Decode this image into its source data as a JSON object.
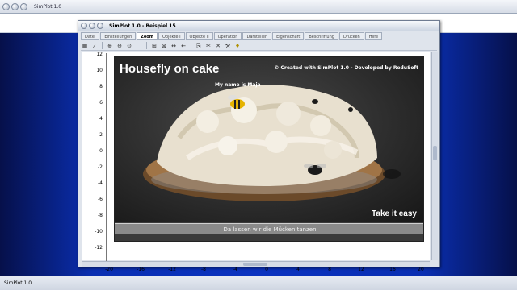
{
  "outer_window": {
    "title": "SimPlot 1.0"
  },
  "statusbar": {
    "text": "SimPlot 1.0"
  },
  "inner_window": {
    "title": "SimPlot 1.0 - Beispiel 15"
  },
  "tabs": [
    "Datei",
    "Einstellungen",
    "Zoom",
    "Objekte I",
    "Objekte II",
    "Operation",
    "Darstellen",
    "Eigenschaft",
    "Beschriftung",
    "Drucken",
    "Hilfe"
  ],
  "active_tab": "Zoom",
  "toolbar": {
    "icons": [
      "calculator-icon",
      "abs-icon",
      "zoom-in-icon",
      "zoom-out-icon",
      "zoom-fit-icon",
      "square-icon",
      "grid-icon",
      "grid-alt-icon",
      "arrow-left-right-icon",
      "arrow-left-icon",
      "copy-icon",
      "cut-icon",
      "delete-icon",
      "tools-icon",
      "help-bulb-icon"
    ]
  },
  "plot": {
    "y_ticks": [
      "12",
      "10",
      "8",
      "6",
      "4",
      "2",
      "0",
      "-2",
      "-4",
      "-6",
      "-8",
      "-10",
      "-12"
    ],
    "x_ticks": [
      "-20",
      "-16",
      "-12",
      "-8",
      "-4",
      "0",
      "4",
      "8",
      "12",
      "16",
      "20"
    ]
  },
  "image": {
    "title": "Housefly on cake",
    "credit": "© Created with SimPlot 1.0 - Developed by ReduSoft",
    "bubble": "My name is Maja",
    "corner": "Take it easy",
    "caption": "Da lassen wir die Mücken tanzen"
  }
}
